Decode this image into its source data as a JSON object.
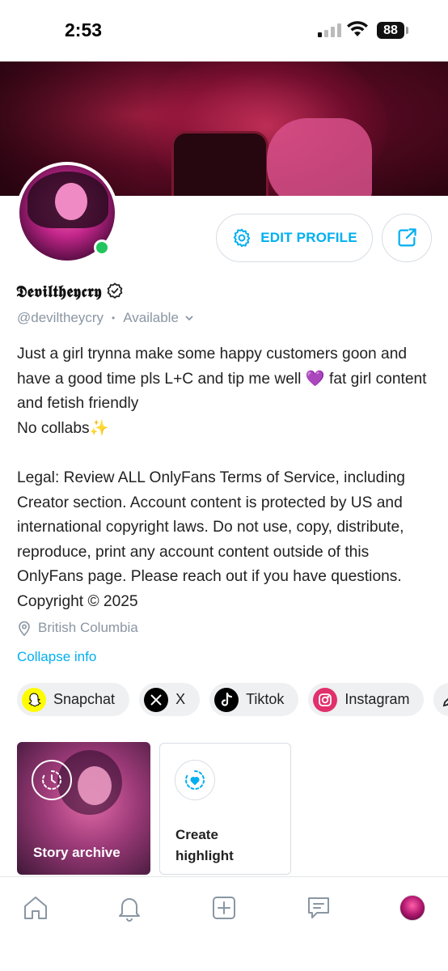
{
  "status_bar": {
    "time": "2:53",
    "battery": "88"
  },
  "profile": {
    "display_name": "𝕯𝖊𝖛𝖎𝖑𝖙𝖍𝖊𝖞𝖈𝖗𝖞",
    "verified": true,
    "handle": "@deviltheycry",
    "separator": "•",
    "availability": "Available",
    "online": true,
    "edit_profile_label": "EDIT PROFILE",
    "bio_lines": [
      "Just a girl trynna make some happy customers goon and have a good time pls L+C and tip me well 💜 fat girl content and fetish friendly",
      "No collabs✨",
      "",
      "Legal: Review ALL OnlyFans Terms of Service, including Creator section. Account content is protected by US and international copyright laws. Do not use, copy, distribute, reproduce, print any account content outside of this OnlyFans page. Please reach out if you have questions. Copyright © 2025"
    ],
    "location": "British Columbia",
    "collapse_label": "Collapse info"
  },
  "socials": [
    {
      "label": "Snapchat",
      "icon": "snapchat-icon",
      "color": "#fffc00"
    },
    {
      "label": "X",
      "icon": "x-icon",
      "color": "#000000"
    },
    {
      "label": "Tiktok",
      "icon": "tiktok-icon",
      "color": "#000000"
    },
    {
      "label": "Instagram",
      "icon": "instagram-icon",
      "color": "#e1306c"
    }
  ],
  "highlights": {
    "story_archive_label": "Story archive",
    "create_highlight_label": "Create highlight"
  },
  "colors": {
    "accent": "#00aff0",
    "muted": "#8a96a3",
    "online": "#22c55e"
  },
  "tab_bar": [
    "home-icon",
    "bell-icon",
    "add-post-icon",
    "messages-icon",
    "profile-avatar"
  ]
}
